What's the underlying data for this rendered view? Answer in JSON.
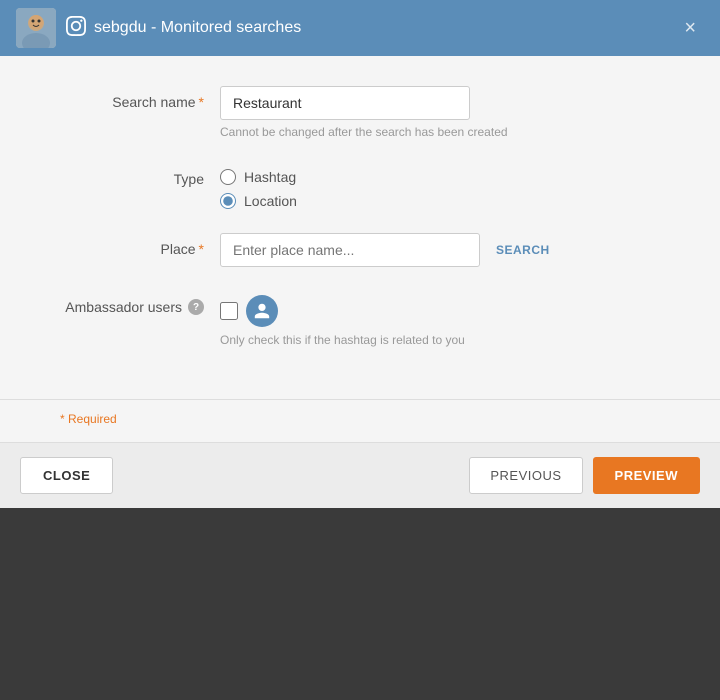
{
  "header": {
    "title": "sebgdu - Monitored searches",
    "close_label": "×",
    "instagram_icon": "instagram-icon"
  },
  "form": {
    "search_name": {
      "label": "Search name",
      "required": true,
      "value": "Restaurant",
      "hint": "Cannot be changed after the search has been created"
    },
    "type": {
      "label": "Type",
      "options": [
        {
          "value": "hashtag",
          "label": "Hashtag",
          "checked": false
        },
        {
          "value": "location",
          "label": "Location",
          "checked": true
        }
      ]
    },
    "place": {
      "label": "Place",
      "required": true,
      "placeholder": "Enter place name...",
      "search_button_label": "SEARCH"
    },
    "ambassador_users": {
      "label": "Ambassador users",
      "hint": "Only check this if the hashtag is related to you"
    }
  },
  "required_note": "* Required",
  "footer": {
    "close_label": "CLOSE",
    "previous_label": "PREVIOUS",
    "preview_label": "PREVIEW"
  }
}
